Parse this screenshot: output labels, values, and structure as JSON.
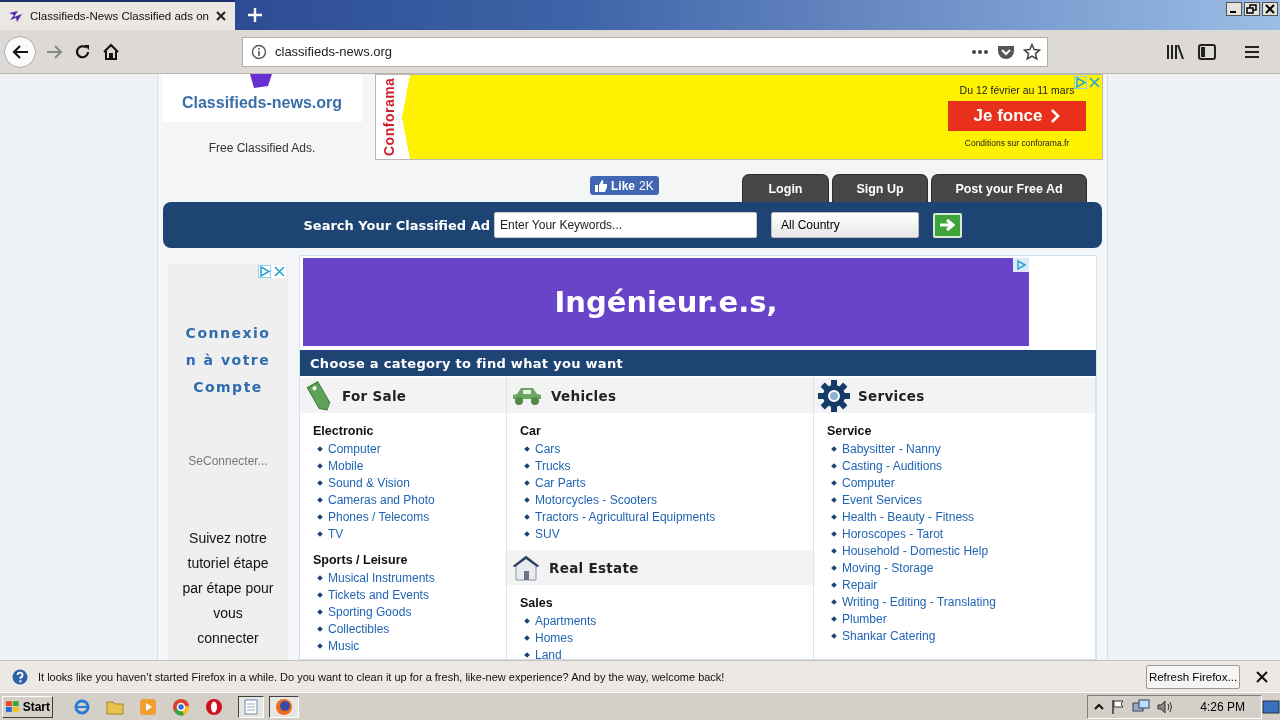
{
  "browser": {
    "tab_title": "Classifieds-News Classified ads on",
    "url": "classifieds-news.org"
  },
  "header": {
    "logo_text": "Classifieds-news.org",
    "tagline": "Free Classified Ads.",
    "top_ad": {
      "brand": "Conforama",
      "dates": "Du 12 février au 11 mars",
      "button": "Je fonce",
      "conditions": "Conditions sur conforama.fr"
    }
  },
  "like": {
    "label": "Like",
    "count": "2K"
  },
  "tabs": [
    {
      "label": "Login"
    },
    {
      "label": "Sign Up"
    },
    {
      "label": "Post your Free Ad"
    }
  ],
  "search": {
    "label": "Search Your Classified Ad",
    "placeholder": "Enter Your Keywords...",
    "country": "All Country"
  },
  "side_ad": {
    "title": "Connexion à votre Compte",
    "link": "SeConnecter...",
    "text": "Suivez notre tutoriel étape par étape pour vous connecter"
  },
  "banner_ad": {
    "text": "Ingénieur.e.s,"
  },
  "categories": {
    "heading": "Choose a category to find what you want",
    "columns": [
      {
        "sections": [
          {
            "title": "For Sale",
            "kind": "tag",
            "groups": [
              {
                "title": "Electronic",
                "items": [
                  "Computer",
                  "Mobile",
                  "Sound & Vision",
                  "Cameras and Photo",
                  "Phones / Telecoms",
                  "TV"
                ]
              },
              {
                "title": "Sports / Leisure",
                "items": [
                  "Musical Instruments",
                  "Tickets and Events",
                  "Sporting Goods",
                  "Collectibles",
                  "Music"
                ]
              }
            ]
          }
        ]
      },
      {
        "sections": [
          {
            "title": "Vehicles",
            "kind": "car",
            "groups": [
              {
                "title": "Car",
                "items": [
                  "Cars",
                  "Trucks",
                  "Car Parts",
                  "Motorcycles - Scooters",
                  "Tractors - Agricultural Equipments",
                  "SUV"
                ]
              }
            ]
          },
          {
            "title": "Real Estate",
            "kind": "house",
            "groups": [
              {
                "title": "Sales",
                "items": [
                  "Apartments",
                  "Homes",
                  "Land"
                ]
              }
            ]
          }
        ]
      },
      {
        "sections": [
          {
            "title": "Services",
            "kind": "gear",
            "groups": [
              {
                "title": "Service",
                "items": [
                  "Babysitter - Nanny",
                  "Casting - Auditions",
                  "Computer",
                  "Event Services",
                  "Health - Beauty - Fitness",
                  "Horoscopes - Tarot",
                  "Household - Domestic Help",
                  "Moving - Storage",
                  "Repair",
                  "Writing - Editing - Translating",
                  "Plumber",
                  "Shankar Catering"
                ]
              }
            ]
          }
        ]
      }
    ]
  },
  "notification": {
    "text": "It looks like you haven’t started Firefox in a while. Do you want to clean it up for a fresh, like-new experience? And by the way, welcome back!",
    "button": "Refresh Firefox..."
  },
  "taskbar": {
    "start": "Start",
    "clock": "4:26 PM"
  }
}
